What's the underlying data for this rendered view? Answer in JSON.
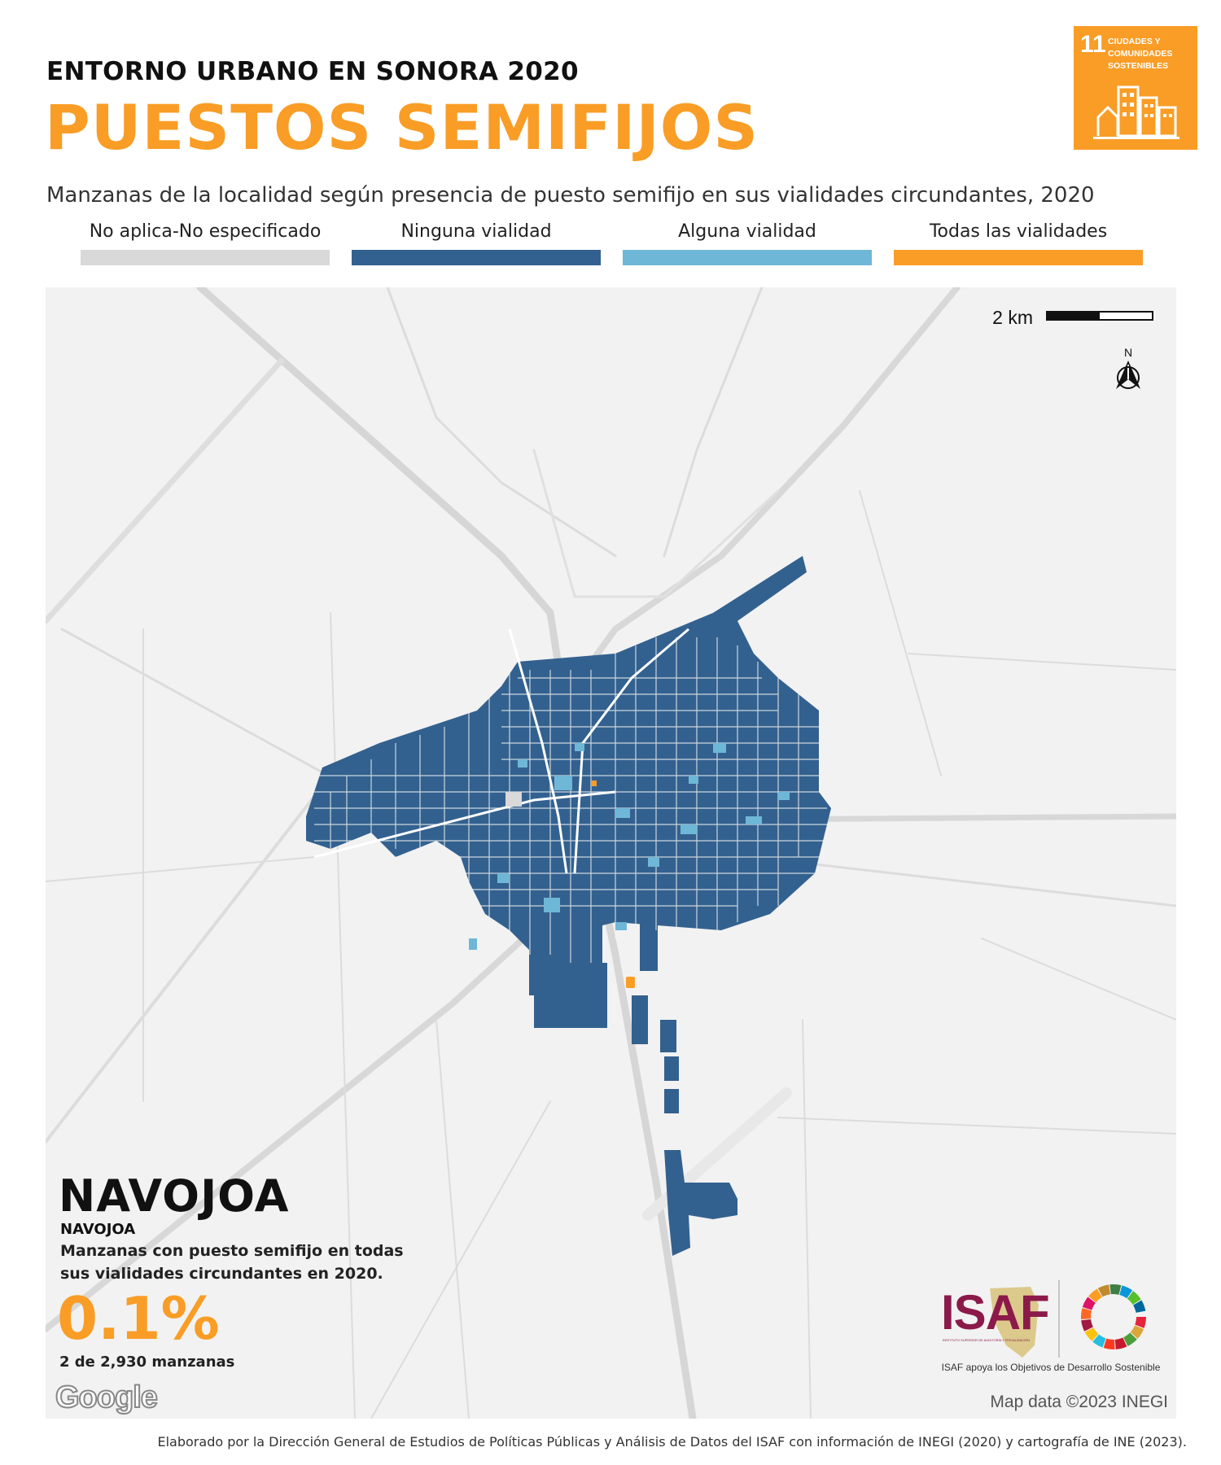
{
  "header": {
    "kicker": "ENTORNO URBANO EN SONORA 2020",
    "title": "PUESTOS SEMIFIJOS",
    "subtitle": "Manzanas de la localidad según presencia de puesto semifijo en sus vialidades circundantes, 2020"
  },
  "sdg_badge": {
    "number": "11",
    "text": "CIUDADES Y COMUNIDADES SOSTENIBLES",
    "color": "#F99D26"
  },
  "legend": [
    {
      "label": "No aplica-No especificado",
      "color": "#D9D9D9"
    },
    {
      "label": "Ninguna vialidad",
      "color": "#33618F"
    },
    {
      "label": "Alguna vialidad",
      "color": "#6FB7D6"
    },
    {
      "label": "Todas las vialidades",
      "color": "#F99D26"
    }
  ],
  "map": {
    "scale_label": "2 km",
    "north_label": "N",
    "place_name": "NAVOJOA",
    "municipality": "NAVOJOA",
    "stat_description": "Manzanas con puesto semifijo en todas sus vialidades circundantes en 2020.",
    "stat_value": "0.1%",
    "stat_count": "2 de 2,930 manzanas",
    "provider_logo": "Google",
    "credit": "Map data ©2023 INEGI"
  },
  "logos": {
    "isaf": "ISAF",
    "isaf_subtitle": "INSTITUTO SUPERIOR DE AUDITORÍA Y FISCALIZACIÓN",
    "sdg_caption": "ISAF apoya los Objetivos de Desarrollo Sostenible"
  },
  "footer": "Elaborado por la Dirección General de Estudios de Políticas Públicas y Análisis de Datos del ISAF con información de INEGI (2020) y cartografía de INE (2023)."
}
